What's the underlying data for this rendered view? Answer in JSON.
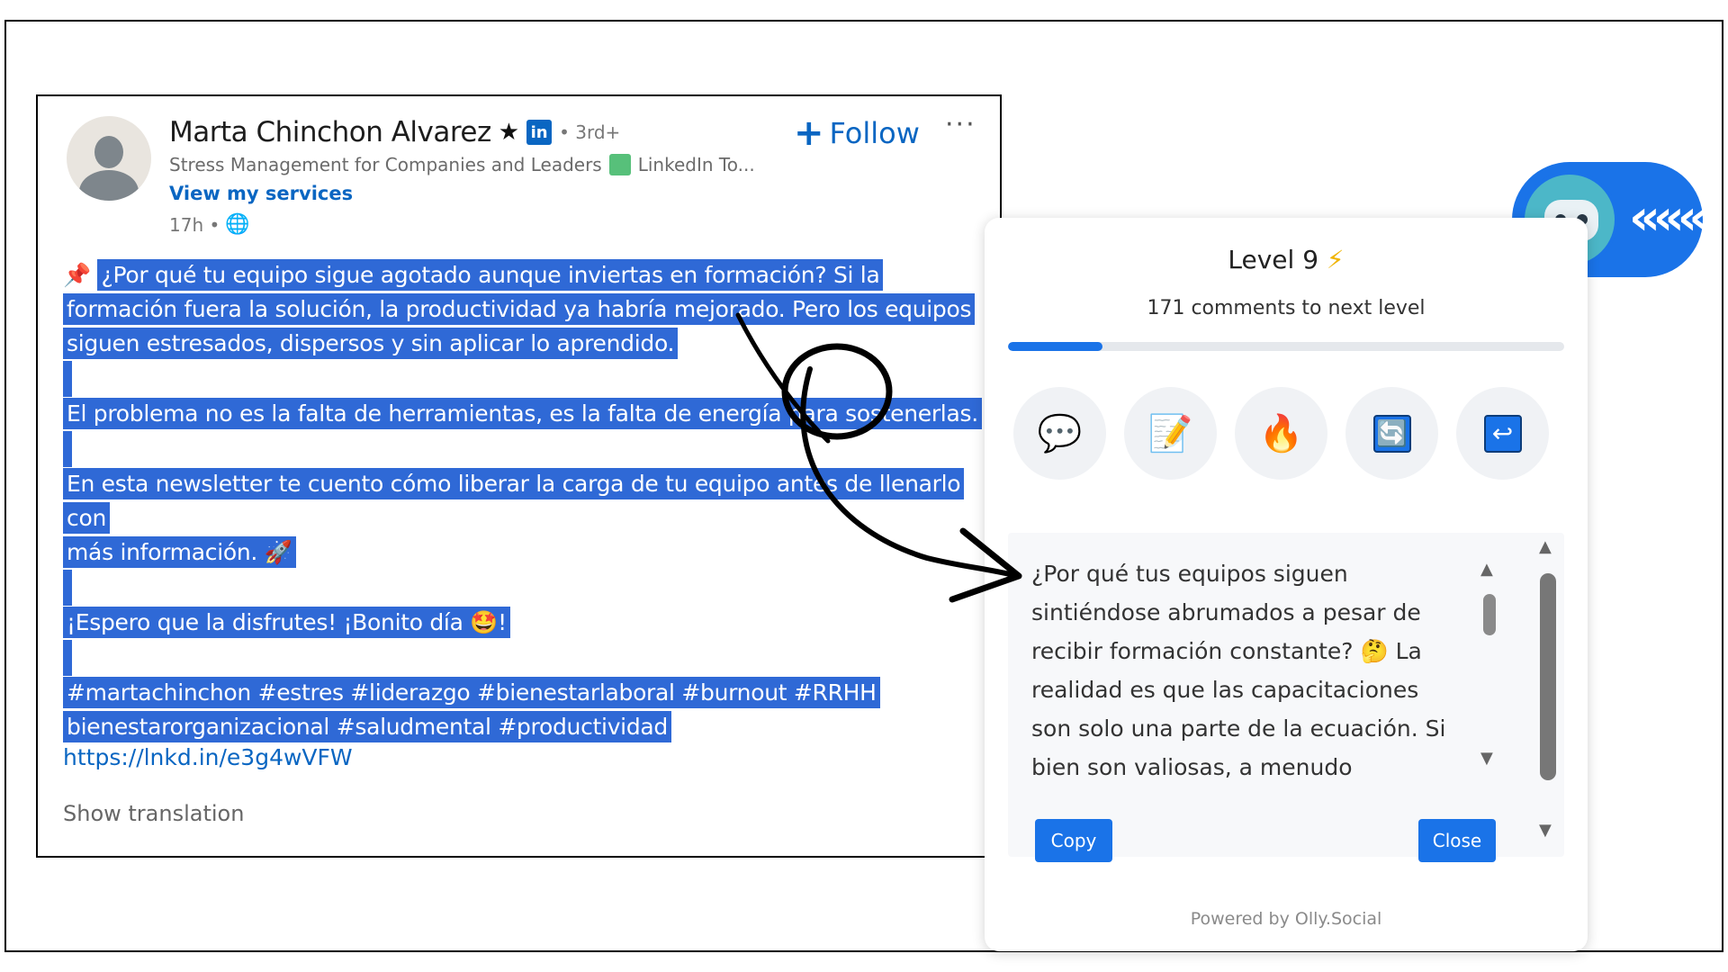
{
  "post": {
    "author_name": "Marta Chinchon Alvarez",
    "star_icon": "★",
    "linkedin_badge": "in",
    "degree": "• 3rd+",
    "headline_left": "Stress Management for Companies and Leaders",
    "headline_right": "LinkedIn To...",
    "services_link": "View my services",
    "time": "17h •",
    "globe_icon": "🌐",
    "follow_label": "Follow",
    "more_label": "···",
    "pin_icon": "📌",
    "lines": {
      "l1": "¿Por qué tu equipo sigue agotado aunque inviertas en formación? Si la",
      "l2": "formación fuera la solución, la productividad ya habría mejorado. Pero los equipos",
      "l3": "siguen estresados, dispersos y sin aplicar lo aprendido.",
      "l4": "El problema no es la falta de herramientas, es la falta de energía para sostenerlas.",
      "l5": "En esta newsletter te cuento cómo liberar la carga de tu equipo antes de llenarlo con",
      "l6": "más información. 🚀",
      "l7": "¡Espero que la disfrutes! ¡Bonito día 🤩!",
      "l8": "#martachinchon #estres #liderazgo #bienestarlaboral #burnout #RRHH",
      "l9": "bienestarorganizacional #saludmental #productividad"
    },
    "link": "https://lnkd.in/e3g4wVFW",
    "show_translation": "Show translation"
  },
  "panel": {
    "level_label": "Level 9",
    "bolt_icon": "⚡",
    "to_next_level": "171 comments to next level",
    "progress_fraction": 0.17,
    "actions": [
      {
        "name": "comment-icon",
        "glyph": "💬"
      },
      {
        "name": "edit-note-icon",
        "glyph": "📝"
      },
      {
        "name": "fire-icon",
        "glyph": "🔥"
      },
      {
        "name": "refresh-icon",
        "glyph": "🔄"
      },
      {
        "name": "return-icon",
        "glyph": "↩"
      }
    ],
    "reply_text": "¿Por qué tus equipos siguen sintiéndose abrumados a pesar de recibir formación constante? 🤔 La realidad es que las capacitaciones son solo una parte de la ecuación. Si bien son valiosas, a menudo",
    "copy_label": "Copy",
    "close_label": "Close",
    "powered_by": "Powered by Olly.Social"
  },
  "bubble": {
    "chevrons": "«««"
  },
  "colors": {
    "highlight": "#2f69d6",
    "linkedin_blue": "#0a66c2",
    "accent": "#1a73e8"
  }
}
